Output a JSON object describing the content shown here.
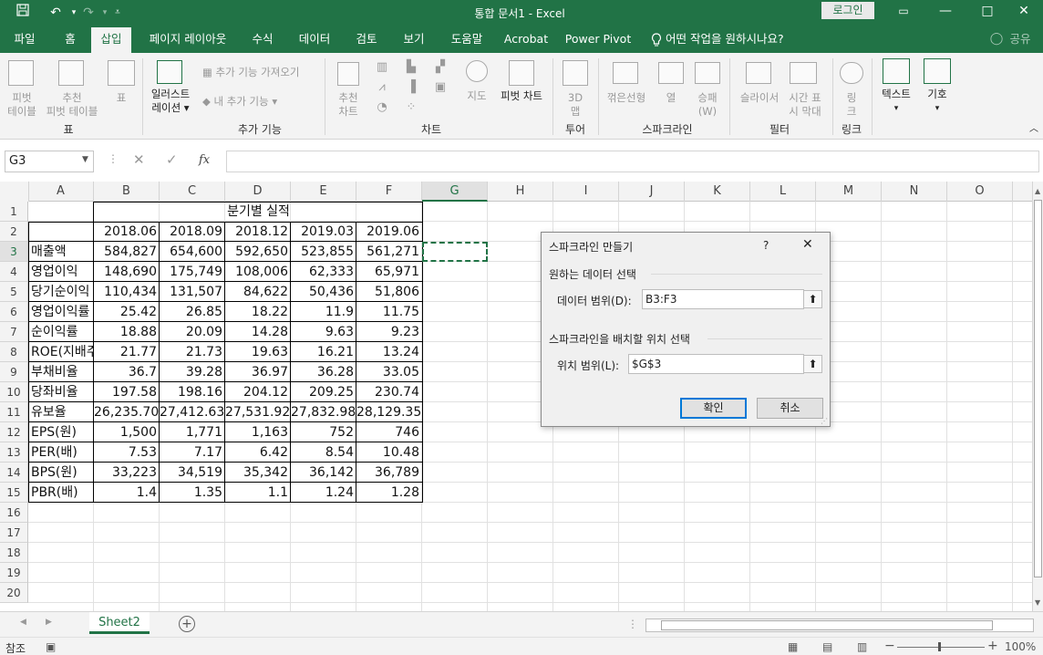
{
  "window": {
    "title": "통합 문서1  -  Excel",
    "login_label": "로그인",
    "qa_save_icon": "save-icon",
    "minimize": "—",
    "restore": "□",
    "close": "✕",
    "ribbon_display": "▭"
  },
  "tabs": [
    {
      "label": "파일"
    },
    {
      "label": "홈"
    },
    {
      "label": "삽입",
      "active": true
    },
    {
      "label": "페이지 레이아웃"
    },
    {
      "label": "수식"
    },
    {
      "label": "데이터"
    },
    {
      "label": "검토"
    },
    {
      "label": "보기"
    },
    {
      "label": "도움말"
    },
    {
      "label": "Acrobat"
    },
    {
      "label": "Power Pivot"
    },
    {
      "label": "어떤 작업을 원하시나요?"
    }
  ],
  "share_label": "공유",
  "ribbon": {
    "pivot": "피벗\n테이블",
    "recommended_pivot": "추천\n피벗 테이블",
    "table": "표",
    "illustrations": "일러스트\n레이션 ▾",
    "get_addins": "추가 기능 가져오기",
    "my_addins": "내 추가 기능",
    "recommended_charts": "추천\n차트",
    "maps": "지도",
    "pivot_chart": "피벗 차트",
    "map3d": "3D\n맵",
    "line_spark": "꺾은선형",
    "column_spark": "열",
    "winloss_spark": "승패\n(W)",
    "slicer": "슬라이서",
    "timeline": "시간 표\n시 막대",
    "link": "링\n크",
    "text": "텍스트",
    "symbol": "기호",
    "groups": {
      "table": "표",
      "addins": "추가 기능",
      "charts": "차트",
      "tours": "투어",
      "sparklines": "스파크라인",
      "filters": "필터",
      "links": "링크"
    }
  },
  "formula_bar": {
    "name_box": "G3",
    "cancel": "✕",
    "enter": "✓",
    "fx": "fx",
    "content": ""
  },
  "columns": [
    "A",
    "B",
    "C",
    "D",
    "E",
    "F",
    "G",
    "H",
    "I",
    "J",
    "K",
    "L",
    "M",
    "N",
    "O"
  ],
  "selected_column": "G",
  "selected_row": "3",
  "rows": [
    "1",
    "2",
    "3",
    "4",
    "5",
    "6",
    "7",
    "8",
    "9",
    "10",
    "11",
    "12",
    "13",
    "14",
    "15",
    "16",
    "17",
    "18",
    "19",
    "20"
  ],
  "sheet": {
    "title": "분기별 실적",
    "periods": [
      "2018.06",
      "2018.09",
      "2018.12",
      "2019.03",
      "2019.06"
    ],
    "data": [
      {
        "label": "매출액",
        "values": [
          "584,827",
          "654,600",
          "592,650",
          "523,855",
          "561,271"
        ]
      },
      {
        "label": "영업이익",
        "values": [
          "148,690",
          "175,749",
          "108,006",
          "62,333",
          "65,971"
        ]
      },
      {
        "label": "당기순이익",
        "values": [
          "110,434",
          "131,507",
          "84,622",
          "50,436",
          "51,806"
        ]
      },
      {
        "label": "영업이익률",
        "values": [
          "25.42",
          "26.85",
          "18.22",
          "11.9",
          "11.75"
        ]
      },
      {
        "label": "순이익률",
        "values": [
          "18.88",
          "20.09",
          "14.28",
          "9.63",
          "9.23"
        ]
      },
      {
        "label": "ROE(지배주",
        "values": [
          "21.77",
          "21.73",
          "19.63",
          "16.21",
          "13.24"
        ]
      },
      {
        "label": "부채비율",
        "values": [
          "36.7",
          "39.28",
          "36.97",
          "36.28",
          "33.05"
        ]
      },
      {
        "label": "당좌비율",
        "values": [
          "197.58",
          "198.16",
          "204.12",
          "209.25",
          "230.74"
        ]
      },
      {
        "label": "유보율",
        "values": [
          "26,235.70",
          "27,412.63",
          "27,531.92",
          "27,832.98",
          "28,129.35"
        ]
      },
      {
        "label": "EPS(원)",
        "values": [
          "1,500",
          "1,771",
          "1,163",
          "752",
          "746"
        ]
      },
      {
        "label": "PER(배)",
        "values": [
          "7.53",
          "7.17",
          "6.42",
          "8.54",
          "10.48"
        ]
      },
      {
        "label": "BPS(원)",
        "values": [
          "33,223",
          "34,519",
          "35,342",
          "36,142",
          "36,789"
        ]
      },
      {
        "label": "PBR(배)",
        "values": [
          "1.4",
          "1.35",
          "1.1",
          "1.24",
          "1.28"
        ]
      }
    ]
  },
  "dialog": {
    "title": "스파크라인 만들기",
    "help": "?",
    "close": "✕",
    "section1": "원하는 데이터 선택",
    "data_range_label": "데이터 범위(D):",
    "data_range_value": "B3:F3",
    "section2": "스파크라인을 배치할 위치 선택",
    "location_label": "위치 범위(L):",
    "location_value": "$G$3",
    "ok": "확인",
    "cancel": "취소"
  },
  "sheet_tabs": [
    {
      "label": "Sheet2",
      "active": true
    }
  ],
  "add_sheet": "+",
  "status": {
    "mode": "참조",
    "zoom": "100%"
  }
}
